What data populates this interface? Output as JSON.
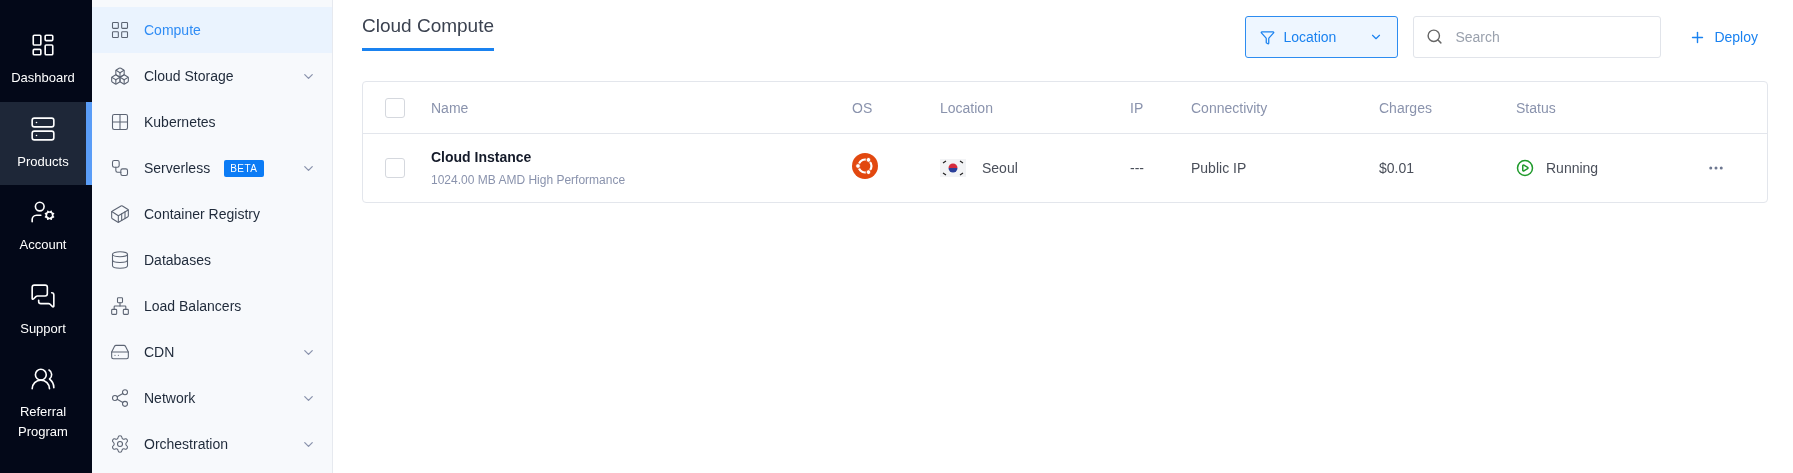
{
  "rail": [
    {
      "label": "Dashboard",
      "selected": false
    },
    {
      "label": "Products",
      "selected": true
    },
    {
      "label": "Account",
      "selected": false
    },
    {
      "label": "Support",
      "selected": false
    },
    {
      "label": "Referral Program",
      "selected": false
    }
  ],
  "sidebar": {
    "items": [
      {
        "label": "Compute",
        "selected": true,
        "expandable": false
      },
      {
        "label": "Cloud Storage",
        "selected": false,
        "expandable": true
      },
      {
        "label": "Kubernetes",
        "selected": false,
        "expandable": false
      },
      {
        "label": "Serverless",
        "selected": false,
        "expandable": true,
        "badge": "BETA"
      },
      {
        "label": "Container Registry",
        "selected": false,
        "expandable": false
      },
      {
        "label": "Databases",
        "selected": false,
        "expandable": false
      },
      {
        "label": "Load Balancers",
        "selected": false,
        "expandable": false
      },
      {
        "label": "CDN",
        "selected": false,
        "expandable": true
      },
      {
        "label": "Network",
        "selected": false,
        "expandable": true
      },
      {
        "label": "Orchestration",
        "selected": false,
        "expandable": true
      }
    ]
  },
  "tabs": [
    {
      "label": "Cloud Compute",
      "selected": true
    }
  ],
  "toolbar": {
    "filter": {
      "label": "Location"
    },
    "search": {
      "placeholder": "Search"
    },
    "deploy": {
      "label": "Deploy"
    }
  },
  "table": {
    "select_all": {
      "checked": false
    },
    "columns": [
      "Name",
      "OS",
      "Location",
      "IP",
      "Connectivity",
      "Charges",
      "Status"
    ],
    "rows": [
      {
        "checked": false,
        "name": "Cloud Instance",
        "plan": "1024.00 MB AMD High Performance",
        "location": "Seoul",
        "ip": "---",
        "connectivity": "Public IP",
        "charges": "$0.01",
        "status": "Running"
      }
    ]
  }
}
